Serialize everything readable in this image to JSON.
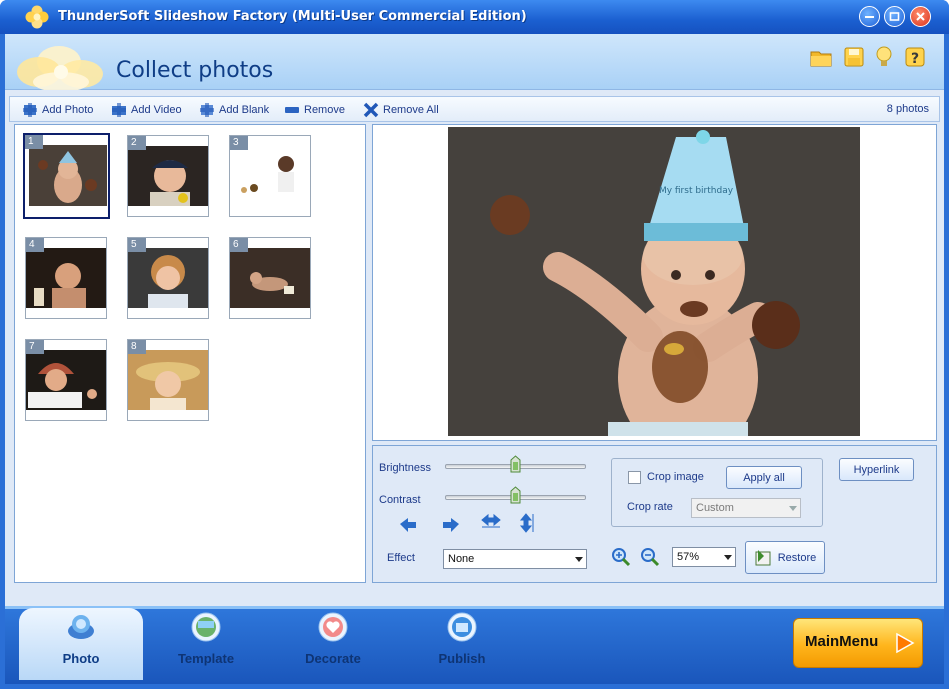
{
  "window": {
    "title": "ThunderSoft Slideshow Factory (Multi-User Commercial Edition)",
    "controls": [
      "minimize",
      "maximize",
      "close"
    ]
  },
  "header": {
    "page_title": "Collect photos",
    "icons": [
      "folder-icon",
      "save-icon",
      "tips-icon",
      "help-icon"
    ]
  },
  "toolbar": {
    "add_photo": "Add Photo",
    "add_video": "Add Video",
    "add_blank": "Add Blank",
    "remove": "Remove",
    "remove_all": "Remove All",
    "photo_count": "8 photos"
  },
  "thumbnails": [
    {
      "num": "1",
      "selected": true
    },
    {
      "num": "2",
      "selected": false
    },
    {
      "num": "3",
      "selected": false
    },
    {
      "num": "4",
      "selected": false
    },
    {
      "num": "5",
      "selected": false
    },
    {
      "num": "6",
      "selected": false
    },
    {
      "num": "7",
      "selected": false
    },
    {
      "num": "8",
      "selected": false
    }
  ],
  "preview": {
    "hat_text": "My first birthday"
  },
  "controls": {
    "brightness_label": "Brightness",
    "contrast_label": "Contrast",
    "brightness_level": 0.5,
    "contrast_level": 0.5,
    "effect_label": "Effect",
    "effect_value": "None",
    "crop_image_label": "Crop image",
    "crop_checked": false,
    "apply_all": "Apply all",
    "crop_rate_label": "Crop rate",
    "crop_rate_value": "Custom",
    "hyperlink": "Hyperlink",
    "zoom_value": "57%",
    "restore": "Restore"
  },
  "bottom_tabs": [
    {
      "label": "Photo",
      "active": true,
      "icon": "photo-icon"
    },
    {
      "label": "Template",
      "active": false,
      "icon": "template-icon"
    },
    {
      "label": "Decorate",
      "active": false,
      "icon": "decorate-icon"
    },
    {
      "label": "Publish",
      "active": false,
      "icon": "publish-icon"
    }
  ],
  "main_menu": "MainMenu",
  "colors": {
    "title_bar": "#1b5fd0",
    "accent_bar": "#2b6fd6",
    "main_menu": "#ffb51c"
  }
}
